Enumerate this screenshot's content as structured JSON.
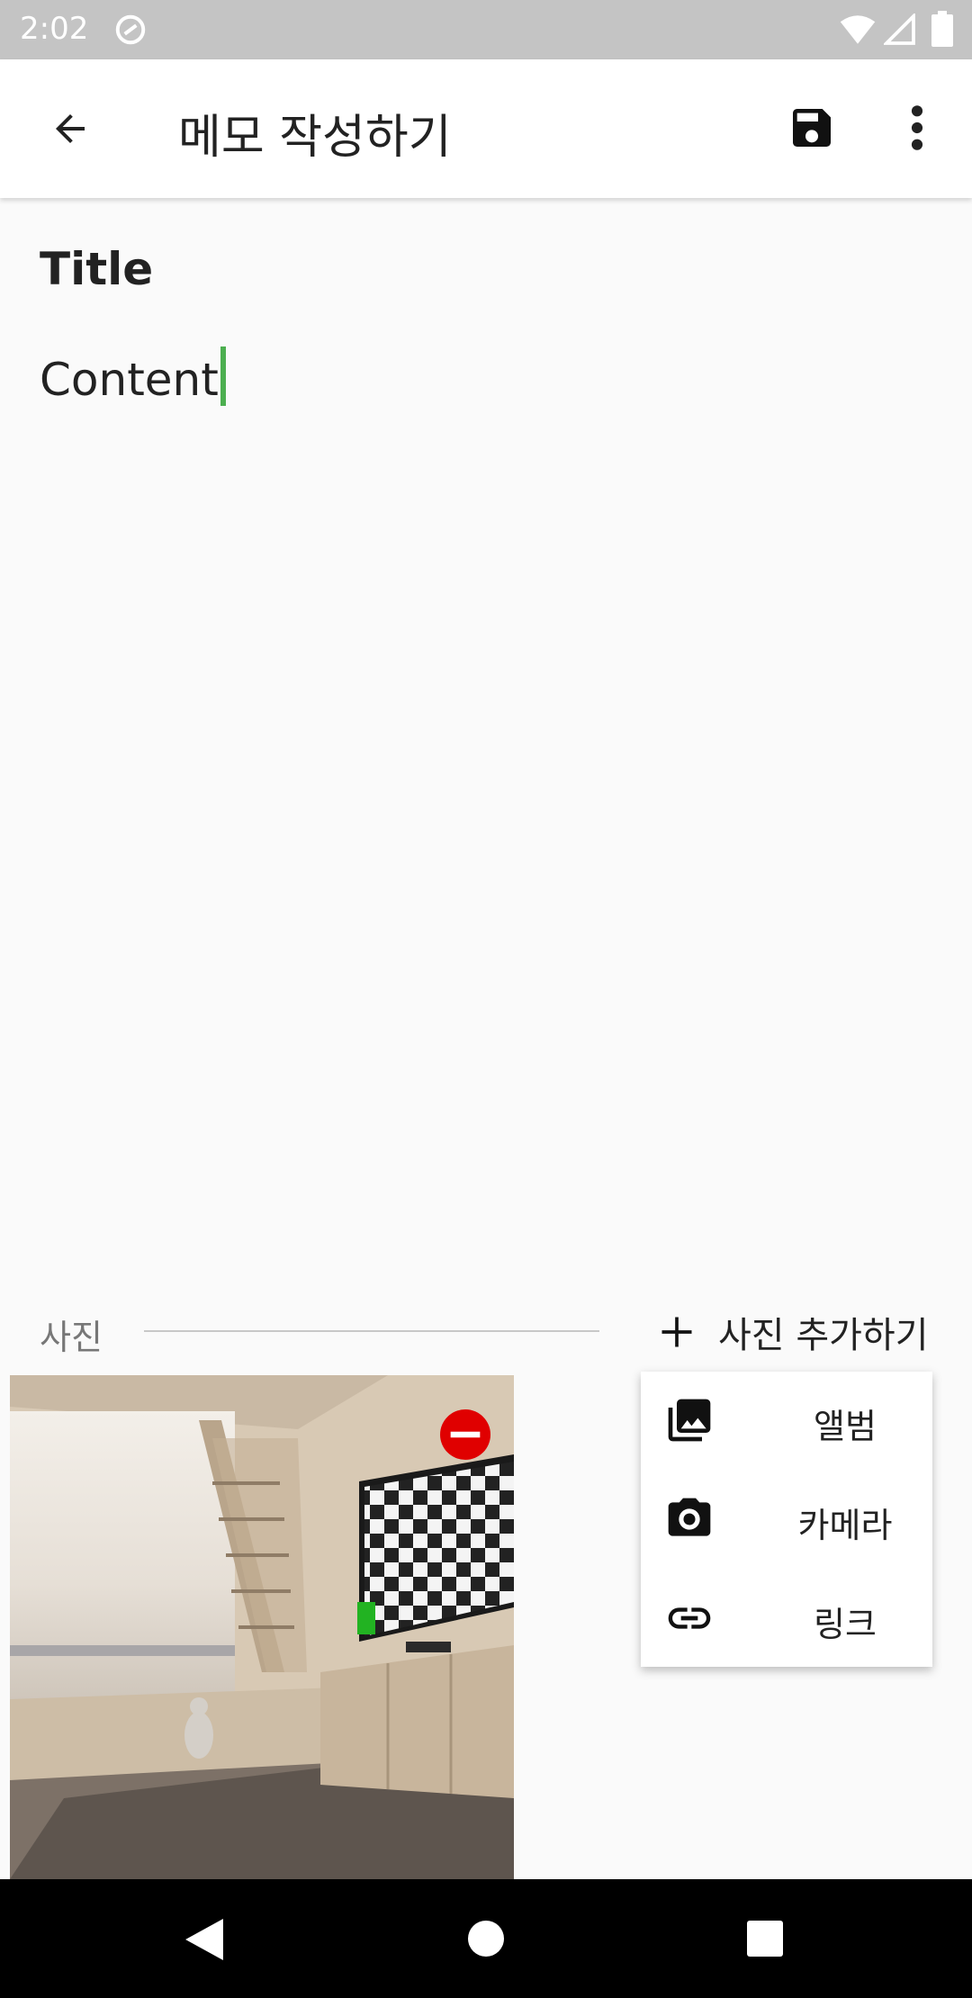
{
  "status_bar": {
    "time": "2:02"
  },
  "toolbar": {
    "title": "메모 작성하기"
  },
  "memo": {
    "title": "Title",
    "content": "Content"
  },
  "photos": {
    "section_label": "사진",
    "add_label": "사진 추가하기"
  },
  "popup": {
    "items": [
      {
        "label": "앨범"
      },
      {
        "label": "카메라"
      },
      {
        "label": "링크"
      }
    ]
  },
  "colors": {
    "accent_cursor": "#4caf50",
    "remove_badge": "#e00000",
    "statusbar": "#c4c4c4"
  },
  "icons": {
    "back": "arrow-left-icon",
    "save": "floppy-disk-icon",
    "more": "more-vert-icon",
    "add": "plus-icon",
    "album": "photo-library-icon",
    "camera": "camera-icon",
    "link": "link-icon",
    "remove": "remove-circle-icon"
  }
}
